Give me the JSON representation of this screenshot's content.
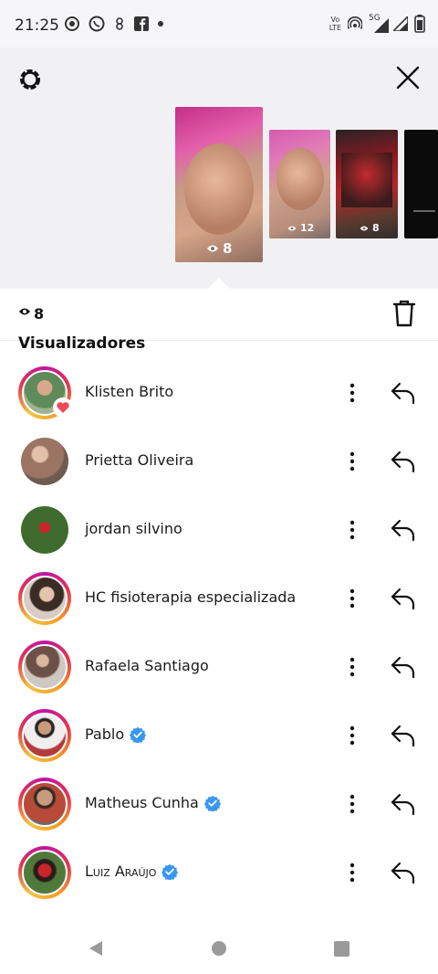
{
  "status_bar": {
    "time": "21:25",
    "left_icons": [
      "radio-icon",
      "whatsapp-icon",
      "app-icon",
      "facebook-icon",
      "dot-icon"
    ],
    "volte_label_top": "Vo",
    "volte_label_bottom": "LTE",
    "network_label": "5G",
    "right_icons": [
      "hotspot-icon",
      "signal-icon",
      "signal-icon",
      "battery-icon"
    ]
  },
  "story_header": {
    "settings_icon": "gear-icon",
    "close_icon": "close-icon",
    "thumbnails": [
      {
        "views": "8",
        "selected": true
      },
      {
        "views": "12",
        "selected": false
      },
      {
        "views": "8",
        "selected": false
      },
      {
        "views": "",
        "selected": false
      }
    ]
  },
  "summary": {
    "view_count": "8",
    "delete_icon": "trash-icon"
  },
  "section_title": "Visualizadores",
  "viewers": [
    {
      "name": "Klisten Brito",
      "verified": false,
      "ring": true,
      "liked": true,
      "avatar_color": "#6b8b6a"
    },
    {
      "name": "Prietta Oliveira",
      "verified": false,
      "ring": false,
      "liked": false,
      "avatar_color": "#9c7464"
    },
    {
      "name": "jordan silvino",
      "verified": false,
      "ring": false,
      "liked": false,
      "avatar_color": "#3f6b2f"
    },
    {
      "name": "HC fisioterapia especializada",
      "verified": false,
      "ring": true,
      "liked": false,
      "avatar_color": "#c9b9a8"
    },
    {
      "name": "Rafaela Santiago",
      "verified": false,
      "ring": true,
      "liked": false,
      "avatar_color": "#a98f84"
    },
    {
      "name": "Pablo",
      "verified": true,
      "ring": true,
      "liked": false,
      "avatar_color": "#b23b3b"
    },
    {
      "name": "Matheus Cunha",
      "verified": true,
      "ring": true,
      "liked": false,
      "avatar_color": "#b84a3a"
    },
    {
      "name": "Luiz Araújo",
      "verified": true,
      "ring": true,
      "liked": false,
      "avatar_color": "#8e2a2a"
    }
  ],
  "colors": {
    "verified_blue": "#3897f0",
    "heart_red": "#ed4956",
    "header_bg": "#f1f1f4"
  }
}
